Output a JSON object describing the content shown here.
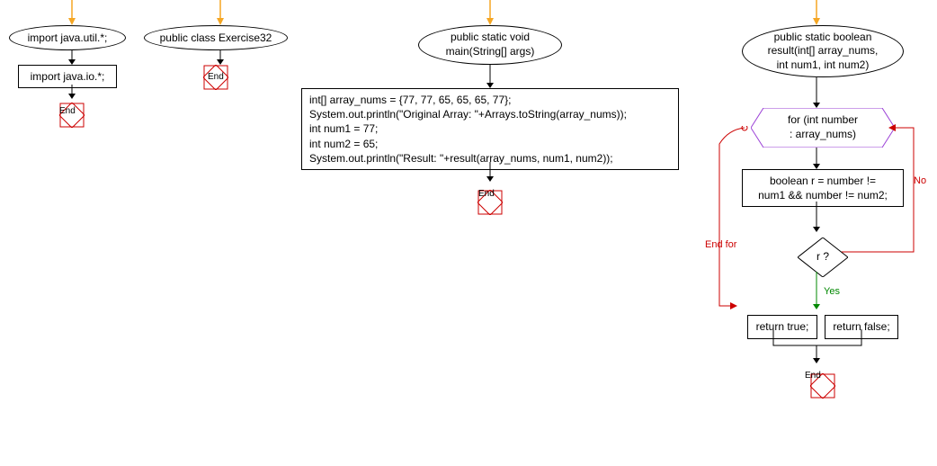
{
  "col1": {
    "import1": "import java.util.*;",
    "import2": "import java.io.*;",
    "end": "End"
  },
  "col2": {
    "class": "public class Exercise32",
    "end": "End"
  },
  "col3": {
    "main_sig_l1": "public static void",
    "main_sig_l2": "main(String[] args)",
    "body_l1": "int[] array_nums = {77, 77, 65, 65, 65, 77};",
    "body_l2": "System.out.println(\"Original Array: \"+Arrays.toString(array_nums));",
    "body_l3": "int num1 = 77;",
    "body_l4": "int num2 = 65;",
    "body_l5": "System.out.println(\"Result: \"+result(array_nums, num1, num2));",
    "end": "End"
  },
  "col4": {
    "sig_l1": "public static boolean",
    "sig_l2": "result(int[] array_nums,",
    "sig_l3": "int num1, int num2)",
    "for_l1": "for (int number",
    "for_l2": ": array_nums)",
    "bool_l1": "boolean r = number !=",
    "bool_l2": "num1 && number != num2;",
    "cond": "r ?",
    "ret_true": "return true;",
    "ret_false": "return false;",
    "end": "End",
    "label_no": "No",
    "label_yes": "Yes",
    "label_endfor": "End for"
  },
  "colors": {
    "arrow_orange": "#f5a623",
    "arrow_black": "#000",
    "arrow_red": "#c00",
    "arrow_green": "#080",
    "hex_border": "#9a3fd6",
    "end_border": "#c00"
  }
}
